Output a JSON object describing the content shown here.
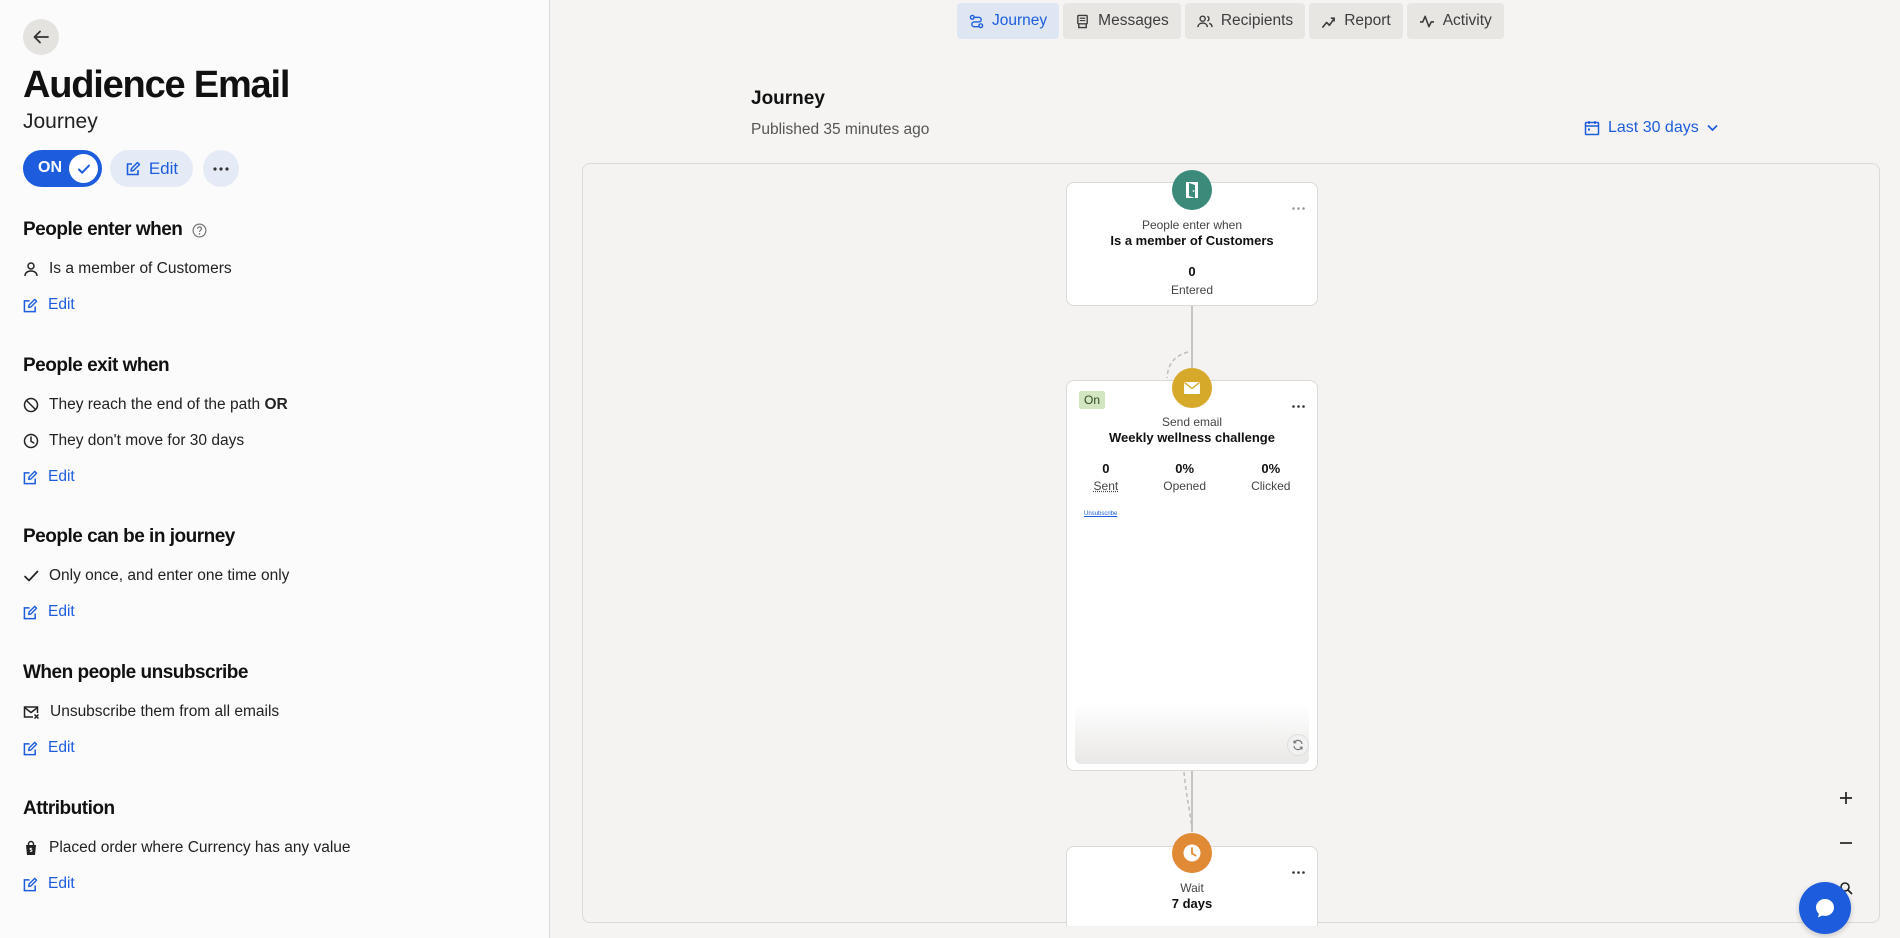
{
  "sidebar": {
    "title": "Audience Email",
    "subtitle": "Journey",
    "toggle_label": "ON",
    "edit_label": "Edit",
    "sections": {
      "enter": {
        "heading": "People enter when",
        "line1": "Is a member of Customers",
        "edit": "Edit"
      },
      "exit": {
        "heading": "People exit when",
        "line1": "They reach the end of the path",
        "line1_bold": "OR",
        "line2": "They don't move for 30 days",
        "edit": "Edit"
      },
      "frequency": {
        "heading": "People can be in journey",
        "line1": "Only once, and enter one time only",
        "edit": "Edit"
      },
      "unsubscribe": {
        "heading": "When people unsubscribe",
        "line1": "Unsubscribe them from all emails",
        "edit": "Edit"
      },
      "attribution": {
        "heading": "Attribution",
        "line1": "Placed order where Currency has any value",
        "edit": "Edit"
      }
    }
  },
  "tabs": [
    {
      "label": "Journey",
      "icon": "journey-icon",
      "active": true
    },
    {
      "label": "Messages",
      "icon": "messages-icon",
      "active": false
    },
    {
      "label": "Recipients",
      "icon": "recipients-icon",
      "active": false
    },
    {
      "label": "Report",
      "icon": "report-icon",
      "active": false
    },
    {
      "label": "Activity",
      "icon": "activity-icon",
      "active": false
    }
  ],
  "main": {
    "title": "Journey",
    "published": "Published 35 minutes ago",
    "date_range": "Last 30 days"
  },
  "flow": {
    "entry": {
      "label": "People enter when",
      "name": "Is a member of Customers",
      "count": "0",
      "count_label": "Entered",
      "icon_color": "#3b8a7a"
    },
    "email": {
      "badge": "On",
      "label": "Send email",
      "name": "Weekly wellness challenge",
      "stats": [
        {
          "value": "0",
          "label": "Sent"
        },
        {
          "value": "0%",
          "label": "Opened"
        },
        {
          "value": "0%",
          "label": "Clicked"
        }
      ],
      "preview_link": "Unsubscribe",
      "icon_color": "#d6a92a"
    },
    "wait": {
      "label": "Wait",
      "name": "7 days",
      "icon_color": "#e08a35"
    }
  },
  "colors": {
    "accent": "#1d5ddd"
  }
}
